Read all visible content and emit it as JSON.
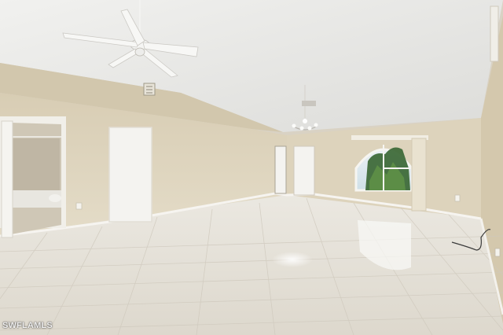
{
  "photo": {
    "description_hidden": "",
    "watermark": "SWFLAMLS",
    "colors": {
      "wall": "#ddd3bc",
      "ceiling": "#ececea",
      "floor": "#e9e6df",
      "baseboard": "#f4f2ee",
      "door": "#f3f2ef",
      "palm": "#3f6b3a"
    }
  }
}
